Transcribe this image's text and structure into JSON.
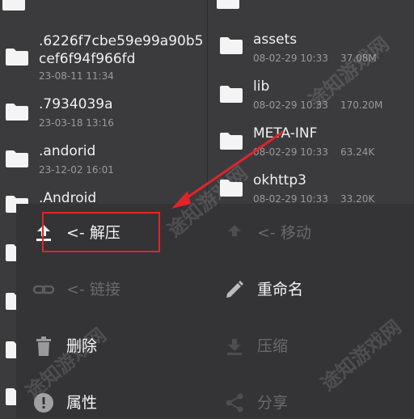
{
  "left_files": [
    {
      "name": ".6226f7cbe59e99a90b5",
      "name2": "cef6f94f966fd",
      "meta": "23-08-11 11:34"
    },
    {
      "name": ".7934039a",
      "meta": "23-03-18 13:16"
    },
    {
      "name": ".andorid",
      "meta": "23-12-02 16:01"
    },
    {
      "name": ".Android",
      "meta": ""
    }
  ],
  "right_files": [
    {
      "name": "assets",
      "date": "08-02-29 10:33",
      "size": "37.08M"
    },
    {
      "name": "lib",
      "date": "08-02-29 10:33",
      "size": "170.20M"
    },
    {
      "name": "META-INF",
      "date": "08-02-29 10:33",
      "size": "63.24K"
    },
    {
      "name": "okhttp3",
      "date": "08-02-29 10:33",
      "size": "33.20K"
    }
  ],
  "actions": {
    "extract": "<- 解压",
    "move": "<- 移动",
    "link": "<- 链接",
    "rename": "重命名",
    "delete": "删除",
    "compress": "压缩",
    "properties": "属性",
    "share": "分享"
  },
  "watermark": "途知游戏网",
  "colors": {
    "highlight": "#e0242b",
    "background": "#3a3a3c"
  }
}
